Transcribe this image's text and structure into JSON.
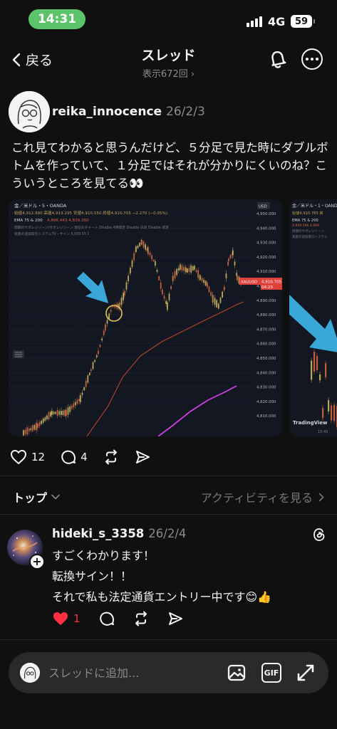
{
  "status_bar": {
    "time": "14:31",
    "network": "4G",
    "battery": "59"
  },
  "header": {
    "back_label": "戻る",
    "title": "スレッド",
    "views": "表示672回"
  },
  "post": {
    "author": "reika_innocence",
    "date": "26/2/3",
    "text": "これ見てわかると思うんだけど、５分足で見た時にダブルボトムを作っていて、１分足ではそれが分かりにくいのね？こういうところを見てる👀",
    "likes": "12",
    "comments": "4",
    "chart": {
      "symbol_line": "金／米ドル・5・OANDA",
      "ohlc_line": "始値4,912.990  高値4,913.295  安値4,910.550  終値4,910.705  −2.270 (−0.05%)",
      "ema_line": "EMA 75 & 200",
      "ema_values": "4,896.443  4,839.360",
      "indicator_line1": "周期のサポレジゾーン/サポレジゾーン 現在のチャート Disable 4時間足 Disable 日足 Disable 週足",
      "indicator_line2": "裁量の遊技取引システムTV・サイン 5,000 55 1",
      "currency": "USD",
      "price_label": "XAUUSD",
      "price_value": "4,910.705",
      "price_time": "04:23",
      "y_ticks": [
        "4,950.000",
        "4,940.000",
        "4,930.000",
        "4,920.000",
        "4,910.000",
        "4,900.000",
        "4,890.000",
        "4,880.000",
        "4,870.000",
        "4,860.000",
        "4,850.000",
        "4,840.000",
        "4,830.000",
        "4,820.000",
        "4,810.000"
      ],
      "second_symbol": "金／米ドル・1・OANDA",
      "second_ohlc": "始値4,910.785 高",
      "second_ema": "EMA 75 & 200",
      "second_ema_values": "4,899.596  4,899",
      "second_ind1": "周期のサポレジゾーン",
      "second_ind2": "裁量の遊技取引システム",
      "watermark": "TradingView",
      "second_time": "15:45",
      "colors": {
        "up": "#b8a95a",
        "down": "#c0603e",
        "ema75": "#b5452f",
        "ema200": "#cf3fe6",
        "arrow": "#39a7d8",
        "background": "#131722"
      }
    }
  },
  "sort": {
    "left_label": "トップ",
    "right_label": "アクティビティを見る"
  },
  "reply": {
    "author": "hideki_s_3358",
    "date": "26/2/4",
    "lines": [
      "すごくわかります！",
      "転換サイン！！",
      "それで私も法定通貨エントリー中です😊👍"
    ],
    "likes": "1"
  },
  "composer": {
    "placeholder": "スレッドに追加...",
    "gif_label": "GIF"
  }
}
